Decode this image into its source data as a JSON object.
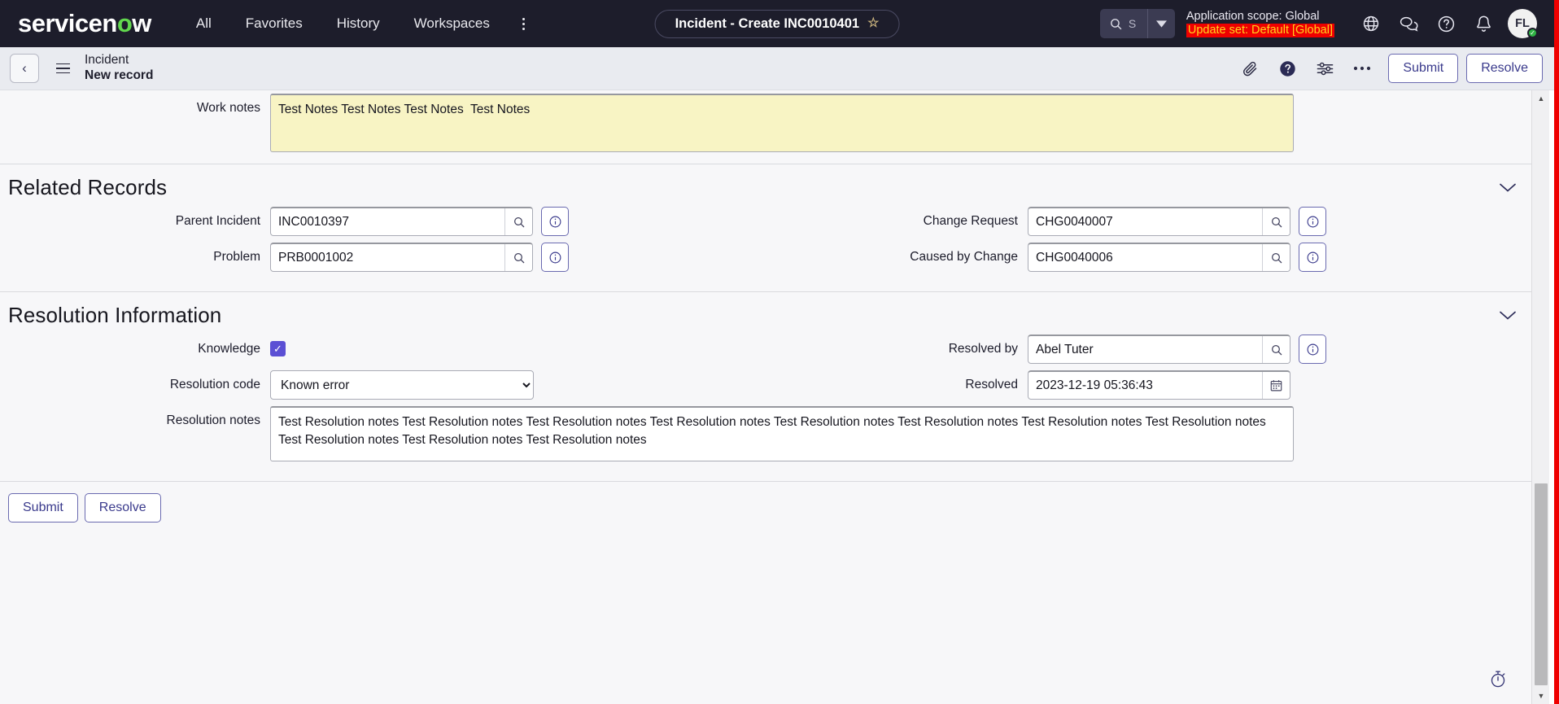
{
  "topnav": {
    "logo_main": "servicen",
    "logo_accent": "o",
    "logo_tail": "w",
    "links": [
      {
        "label": "All"
      },
      {
        "label": "Favorites"
      },
      {
        "label": "History"
      },
      {
        "label": "Workspaces"
      }
    ],
    "kebab": "more-menu",
    "title_pill": "Incident - Create INC0010401",
    "star": "☆",
    "search_text": "S",
    "scope_app": "Application scope: Global",
    "scope_update": "Update set: Default [Global]",
    "avatar_initials": "FL",
    "icons": [
      "globe-icon",
      "conversations-icon",
      "help-icon",
      "notifications-icon"
    ]
  },
  "formbar": {
    "back": "‹",
    "record_type": "Incident",
    "record_state": "New record",
    "submit_label": "Submit",
    "resolve_label": "Resolve"
  },
  "work_notes": {
    "label": "Work notes",
    "value": "Test Notes Test Notes Test Notes  Test Notes"
  },
  "related_records": {
    "heading": "Related Records",
    "fields": {
      "parent_incident": {
        "label": "Parent Incident",
        "value": "INC0010397"
      },
      "problem": {
        "label": "Problem",
        "value": "PRB0001002"
      },
      "change_request": {
        "label": "Change Request",
        "value": "CHG0040007"
      },
      "caused_by_change": {
        "label": "Caused by Change",
        "value": "CHG0040006"
      }
    }
  },
  "resolution_information": {
    "heading": "Resolution Information",
    "knowledge": {
      "label": "Knowledge",
      "checked": true,
      "check_glyph": "✓"
    },
    "resolution_code": {
      "label": "Resolution code",
      "value": "Known error",
      "options": [
        "Known error"
      ]
    },
    "resolved_by": {
      "label": "Resolved by",
      "value": "Abel Tuter"
    },
    "resolved": {
      "label": "Resolved",
      "value": "2023-12-19 05:36:43"
    },
    "resolution_notes": {
      "label": "Resolution notes",
      "value": "Test Resolution notes Test Resolution notes Test Resolution notes Test Resolution notes Test Resolution notes Test Resolution notes Test Resolution notes Test Resolution notes Test Resolution notes Test Resolution notes Test Resolution notes"
    }
  },
  "bottom_actions": {
    "submit_label": "Submit",
    "resolve_label": "Resolve"
  },
  "footer": {
    "timer_icon": "stopwatch-icon"
  },
  "colors": {
    "nav_bg": "#1d1d2b",
    "accent_green": "#62d84e",
    "update_set_bg": "#ef0000",
    "update_set_fg": "#ffd21e",
    "button_fg": "#3a3a8c",
    "checkbox": "#5b4fd4",
    "work_notes_bg": "#f8f4c4",
    "frame_red": "#ef0000"
  }
}
